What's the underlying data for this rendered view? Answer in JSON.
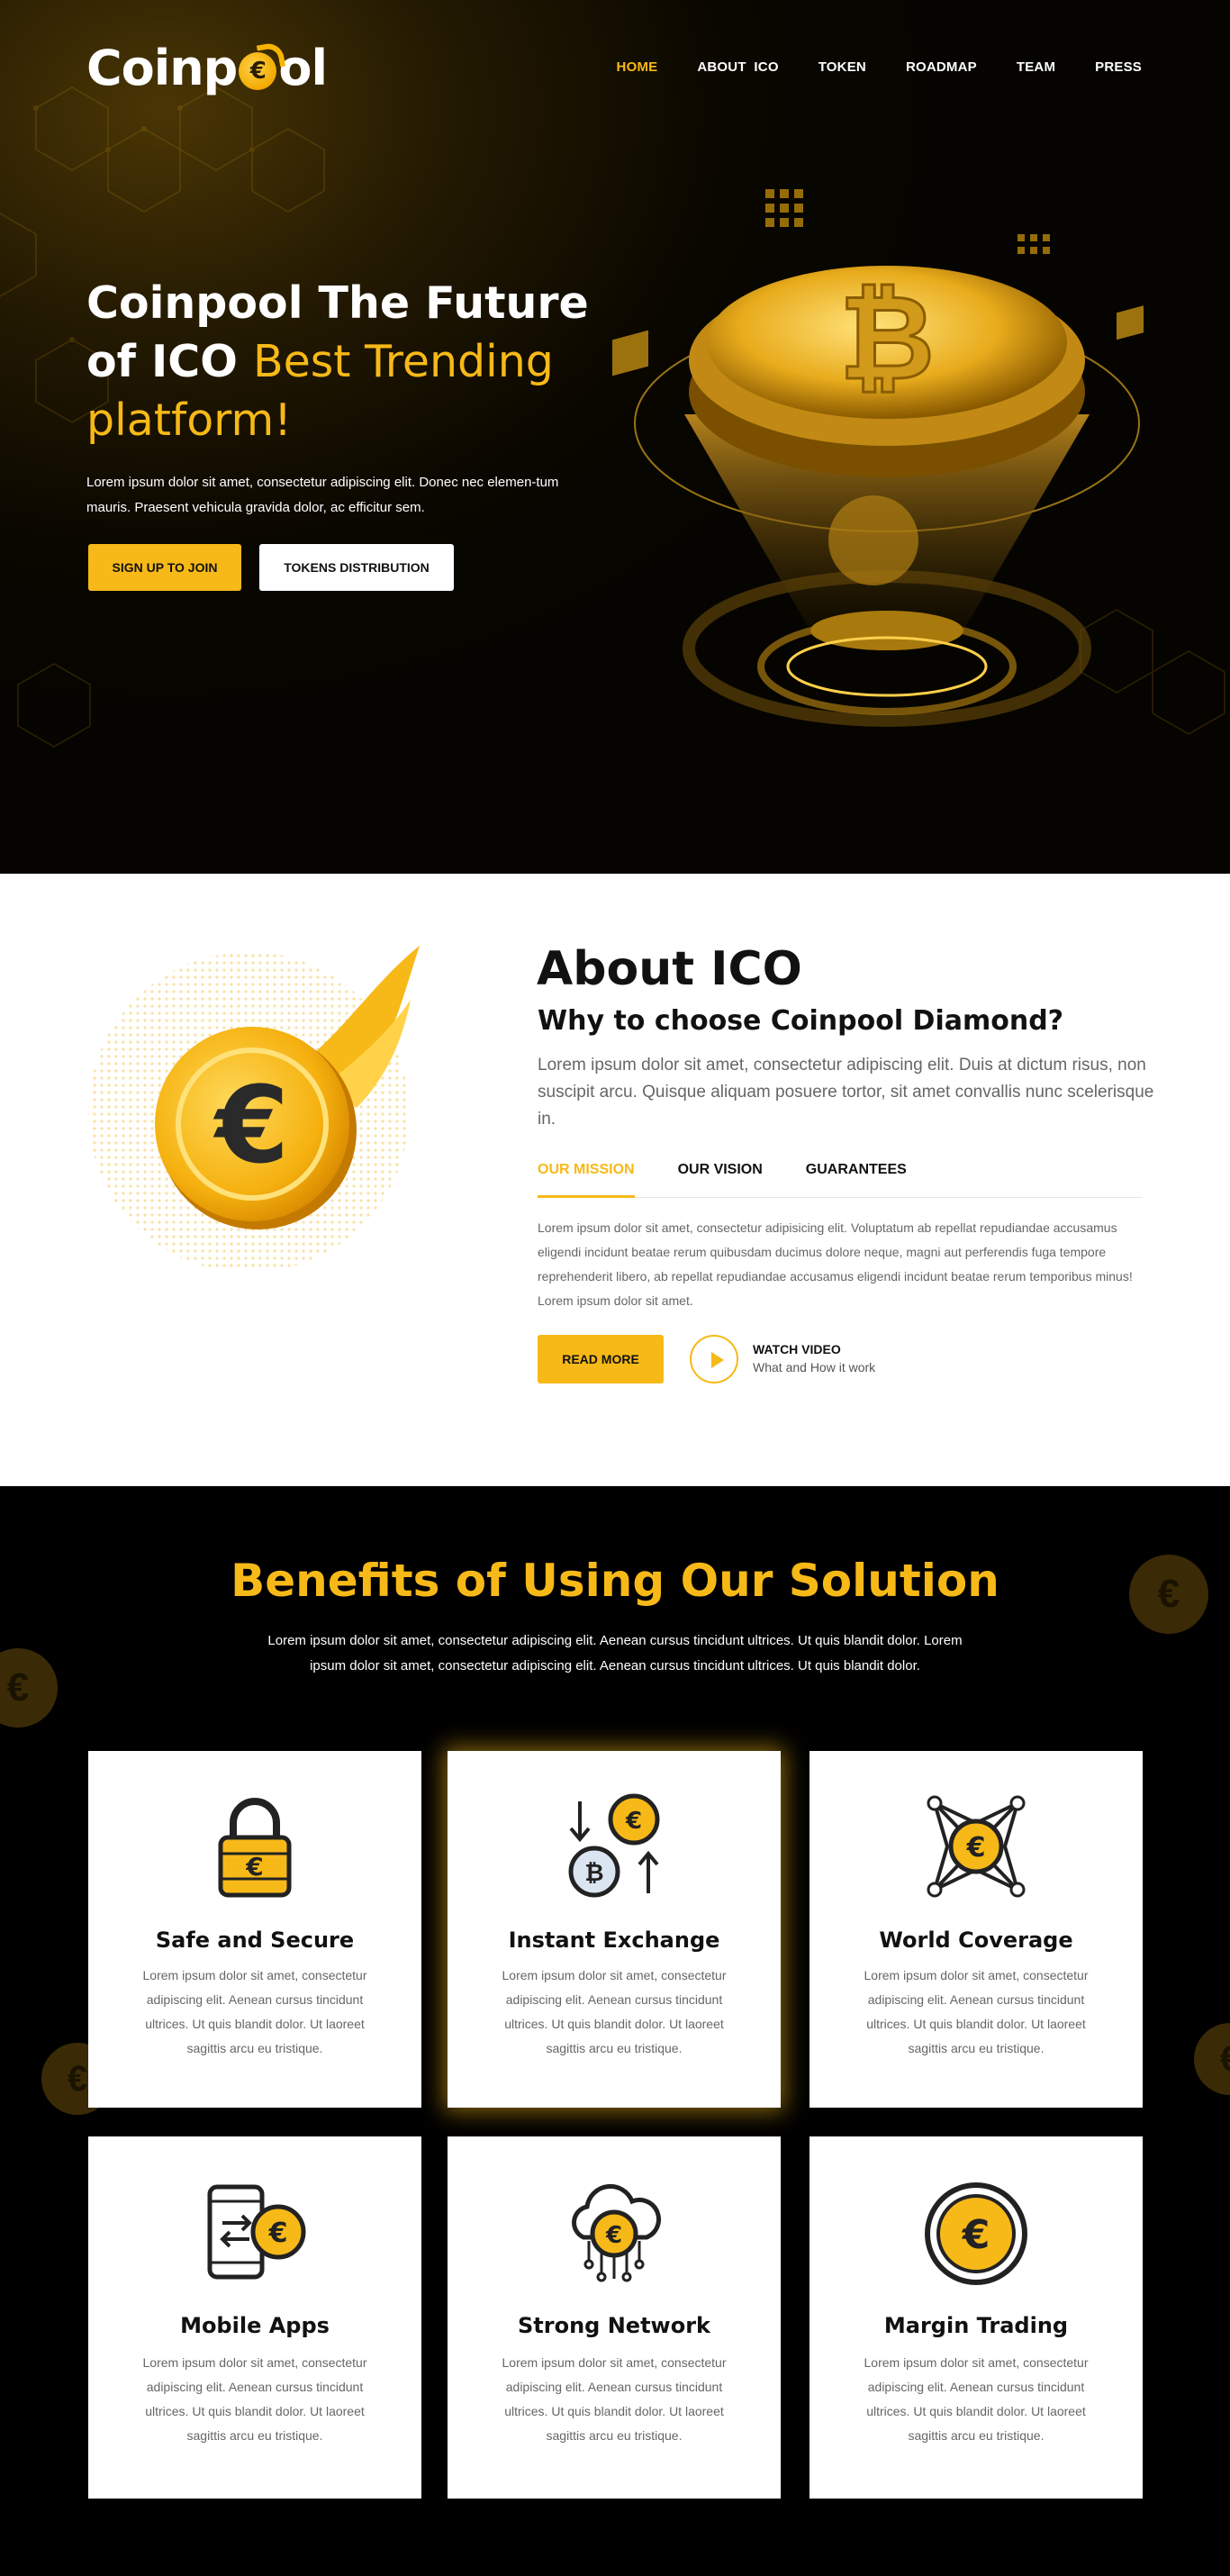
{
  "header": {
    "logo": {
      "text_before": "Coinp",
      "coin_symbol": "€",
      "text_after": "ol"
    },
    "nav": [
      {
        "label": "HOME",
        "active": true
      },
      {
        "label": "ABOUT  ICO",
        "active": false
      },
      {
        "label": "TOKEN",
        "active": false
      },
      {
        "label": "ROADMAP",
        "active": false
      },
      {
        "label": "TEAM",
        "active": false
      },
      {
        "label": "PRESS",
        "active": false
      }
    ]
  },
  "hero": {
    "title_line1": "Coinpool The Future",
    "title_line2_white": "of ICO ",
    "title_line2_accent": "Best Trending",
    "title_line3_accent": "platform!",
    "text": "Lorem ipsum dolor sit amet, consectetur adipiscing elit. Donec nec elemen-tum mauris. Praesent vehicula gravida dolor, ac efficitur sem.",
    "btn_primary": "SIGN UP TO JOIN",
    "btn_secondary": "TOKENS DISTRIBUTION"
  },
  "about": {
    "title": "About ICO",
    "subtitle": "Why to choose Coinpool Diamond?",
    "intro": "Lorem ipsum dolor sit amet, consectetur adipiscing elit. Duis at dictum risus, non suscipit arcu. Quisque aliquam posuere tortor, sit amet convallis nunc scelerisque in.",
    "tabs": [
      {
        "label": "OUR MISSION",
        "active": true
      },
      {
        "label": "OUR VISION",
        "active": false
      },
      {
        "label": "GUARANTEES",
        "active": false
      }
    ],
    "body": "Lorem ipsum dolor sit amet, consectetur adipisicing elit. Voluptatum ab repellat repudiandae accusamus eligendi incidunt beatae rerum quibusdam ducimus dolore neque, magni aut perferendis fuga tempore reprehenderit libero, ab repellat repudiandae accusamus eligendi incidunt beatae rerum temporibus minus! Lorem ipsum dolor sit amet.",
    "read_more": "READ MORE",
    "watch_title": "WATCH VIDEO",
    "watch_sub": "What and How it work",
    "coin_symbol": "€"
  },
  "benefits": {
    "title": "Benefits of Using Our Solution",
    "text": "Lorem ipsum dolor sit amet, consectetur adipiscing elit. Aenean cursus tincidunt ultrices. Ut quis blandit dolor. Lorem ipsum dolor sit amet, consectetur adipiscing elit. Aenean cursus tincidunt ultrices. Ut quis blandit dolor.",
    "cards": [
      {
        "icon": "padlock-coin-icon",
        "title": "Safe and Secure",
        "text": "Lorem ipsum dolor sit amet, consectetur adipiscing elit. Aenean cursus tincidunt ultrices. Ut quis blandit dolor. Ut laoreet sagittis arcu eu tristique."
      },
      {
        "icon": "coin-exchange-icon",
        "title": "Instant Exchange",
        "text": "Lorem ipsum dolor sit amet, consectetur adipiscing elit. Aenean cursus tincidunt ultrices. Ut quis blandit dolor. Ut laoreet sagittis arcu eu tristique."
      },
      {
        "icon": "network-globe-coin-icon",
        "title": "World Coverage",
        "text": "Lorem ipsum dolor sit amet, consectetur adipiscing elit. Aenean cursus tincidunt ultrices. Ut quis blandit dolor. Ut laoreet sagittis arcu eu tristique."
      },
      {
        "icon": "mobile-coin-icon",
        "title": "Mobile Apps",
        "text": "Lorem ipsum dolor sit amet, consectetur adipiscing elit. Aenean cursus tincidunt ultrices. Ut quis blandit dolor. Ut laoreet sagittis arcu eu tristique."
      },
      {
        "icon": "cloud-network-coin-icon",
        "title": "Strong Network",
        "text": "Lorem ipsum dolor sit amet, consectetur adipiscing elit. Aenean cursus tincidunt ultrices. Ut quis blandit dolor. Ut laoreet sagittis arcu eu tristique."
      },
      {
        "icon": "coin-icon",
        "title": "Margin Trading",
        "text": "Lorem ipsum dolor sit amet, consectetur adipiscing elit. Aenean cursus tincidunt ultrices. Ut quis blandit dolor. Ut laoreet sagittis arcu eu tristique."
      }
    ]
  },
  "colors": {
    "accent": "#f7b918",
    "dark": "#000000",
    "text_muted": "#666666"
  }
}
